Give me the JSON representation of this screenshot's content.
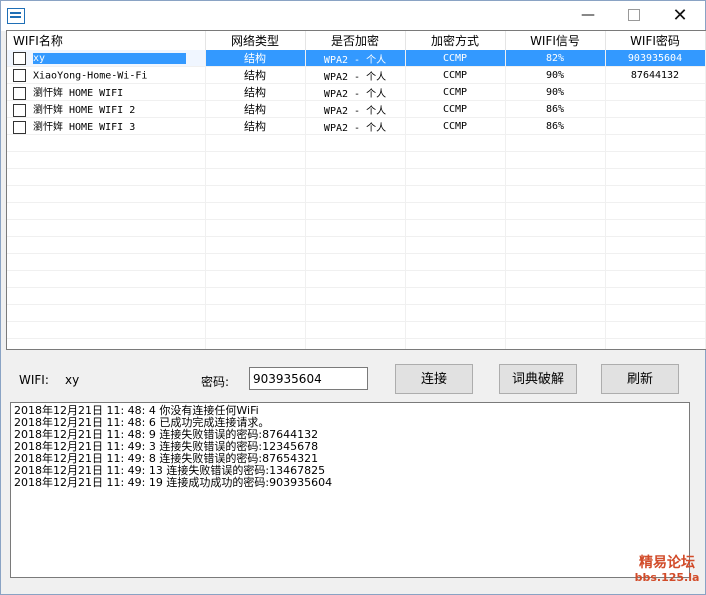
{
  "window": {
    "title": ""
  },
  "buttons": {
    "minimize": "—",
    "close": "✕"
  },
  "table": {
    "headers": [
      "WIFI名称",
      "网络类型",
      "是否加密",
      "加密方式",
      "WIFI信号",
      "WIFI密码"
    ],
    "rows": [
      {
        "name": "xy",
        "type": "结构",
        "encrypt": "WPA2 - 个人",
        "method": "CCMP",
        "signal": "82%",
        "password": "903935604",
        "selected": true
      },
      {
        "name": "XiaoYong-Home-Wi-Fi",
        "type": "结构",
        "encrypt": "WPA2 - 个人",
        "method": "CCMP",
        "signal": "90%",
        "password": "87644132",
        "selected": false
      },
      {
        "name": "瀏忓姩 HOME WIFI",
        "type": "结构",
        "encrypt": "WPA2 - 个人",
        "method": "CCMP",
        "signal": "90%",
        "password": "",
        "selected": false
      },
      {
        "name": "瀏忓姩 HOME WIFI 2",
        "type": "结构",
        "encrypt": "WPA2 - 个人",
        "method": "CCMP",
        "signal": "86%",
        "password": "",
        "selected": false
      },
      {
        "name": "瀏忓姩 HOME WIFI 3",
        "type": "结构",
        "encrypt": "WPA2 - 个人",
        "method": "CCMP",
        "signal": "86%",
        "password": "",
        "selected": false
      }
    ]
  },
  "controls": {
    "wifi_label": "WIFI:",
    "wifi_value": "xy",
    "password_label": "密码:",
    "password_value": "903935604",
    "connect": "连接",
    "dictionary": "词典破解",
    "refresh": "刷新"
  },
  "log": [
    "2018年12月21日 11: 48: 4 你没有连接任何WiFi",
    "2018年12月21日 11: 48: 6 已成功完成连接请求。",
    "2018年12月21日 11: 48: 9 连接失败错误的密码:87644132",
    "2018年12月21日 11: 49: 3 连接失败错误的密码:12345678",
    "2018年12月21日 11: 49: 8 连接失败错误的密码:87654321",
    "2018年12月21日 11: 49: 13 连接失败错误的密码:13467825",
    "2018年12月21日 11: 49: 19 连接成功成功的密码:903935604"
  ],
  "watermark": {
    "title": "精易论坛",
    "url": "bbs.125.la"
  }
}
